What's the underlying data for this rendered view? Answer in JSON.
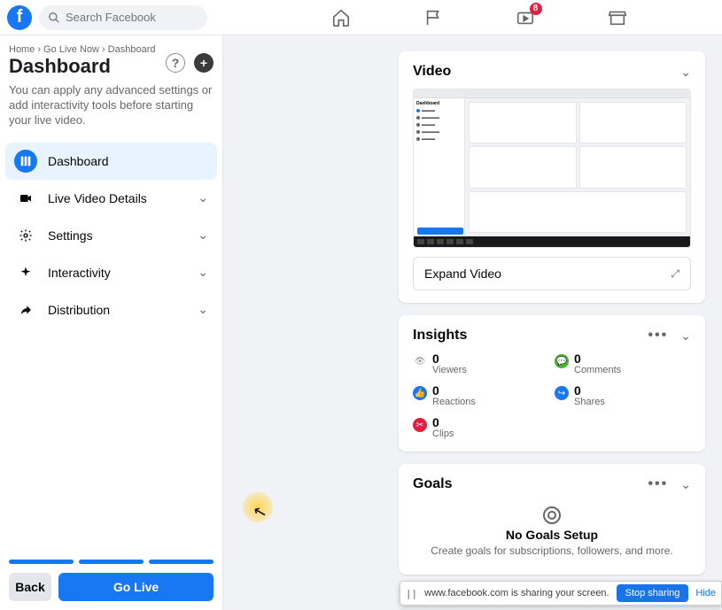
{
  "topnav": {
    "search_placeholder": "Search Facebook",
    "watch_badge": "8"
  },
  "sidebar": {
    "breadcrumb": [
      "Home",
      "Go Live Now",
      "Dashboard"
    ],
    "title": "Dashboard",
    "description": "You can apply any advanced settings or add interactivity tools before starting your live video.",
    "items": [
      {
        "label": "Dashboard",
        "expandable": false,
        "active": true
      },
      {
        "label": "Live Video Details",
        "expandable": true
      },
      {
        "label": "Settings",
        "expandable": true
      },
      {
        "label": "Interactivity",
        "expandable": true
      },
      {
        "label": "Distribution",
        "expandable": true
      }
    ],
    "back_label": "Back",
    "golive_label": "Go Live"
  },
  "video": {
    "title": "Video",
    "expand_label": "Expand Video"
  },
  "insights": {
    "title": "Insights",
    "items": [
      {
        "value": "0",
        "label": "Viewers",
        "kind": "eye"
      },
      {
        "value": "0",
        "label": "Comments",
        "kind": "cmt"
      },
      {
        "value": "0",
        "label": "Reactions",
        "kind": "like"
      },
      {
        "value": "0",
        "label": "Shares",
        "kind": "share"
      },
      {
        "value": "0",
        "label": "Clips",
        "kind": "clip"
      }
    ]
  },
  "goals": {
    "title": "Goals",
    "empty_title": "No Goals Setup",
    "empty_sub": "Create goals for subscriptions, followers, and more."
  },
  "share_bar": {
    "text": "www.facebook.com is sharing your screen.",
    "stop": "Stop sharing",
    "hide": "Hide"
  }
}
